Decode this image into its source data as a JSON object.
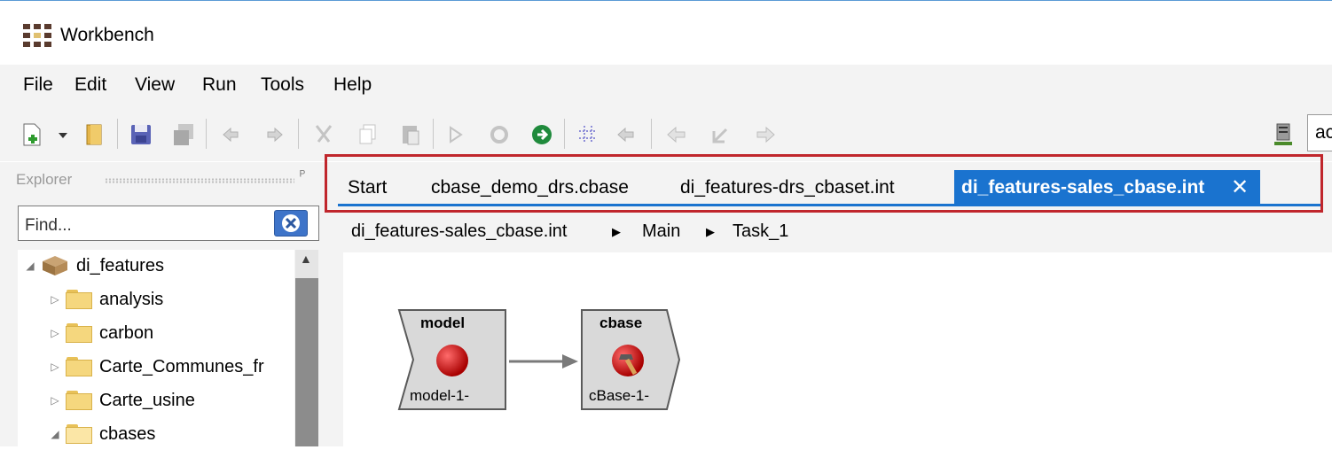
{
  "window": {
    "title": "Workbench"
  },
  "menu": [
    "File",
    "Edit",
    "View",
    "Run",
    "Tools",
    "Help"
  ],
  "toolbar": {
    "icons": [
      "new-file-icon",
      "dropdown-arrow-icon",
      "open-icon",
      "save-icon",
      "save-all-icon",
      "undo-icon",
      "redo-icon",
      "cut-icon",
      "copy-icon",
      "paste-icon",
      "run-icon",
      "refresh-icon",
      "go-icon",
      "grid-icon",
      "back-icon",
      "prev-icon",
      "export-icon",
      "next-icon",
      "server-icon"
    ],
    "search_value": "ac"
  },
  "explorer": {
    "title": "Explorer",
    "find_placeholder": "Find...",
    "tree": [
      {
        "label": "di_features",
        "expanded": true,
        "level": 0,
        "icon": "package-icon"
      },
      {
        "label": "analysis",
        "expanded": false,
        "level": 1,
        "icon": "folder-icon"
      },
      {
        "label": "carbon",
        "expanded": false,
        "level": 1,
        "icon": "folder-icon"
      },
      {
        "label": "Carte_Communes_fr",
        "expanded": false,
        "level": 1,
        "icon": "folder-icon"
      },
      {
        "label": "Carte_usine",
        "expanded": false,
        "level": 1,
        "icon": "folder-icon"
      },
      {
        "label": "cbases",
        "expanded": true,
        "level": 1,
        "icon": "folder-open-icon"
      }
    ]
  },
  "editor": {
    "tabs": [
      {
        "label": "Start",
        "active": false
      },
      {
        "label": "cbase_demo_drs.cbase",
        "active": false
      },
      {
        "label": "di_features-drs_cbaset.int",
        "active": false
      },
      {
        "label": "di_features-sales_cbase.int",
        "active": true
      }
    ],
    "breadcrumb": [
      "di_features-sales_cbase.int",
      "Main",
      "Task_1"
    ],
    "nodes": [
      {
        "title": "model",
        "label": "model-1-"
      },
      {
        "title": "cbase",
        "label": "cBase-1-"
      }
    ]
  },
  "colors": {
    "accent": "#1a73cf",
    "highlight": "#c0262c"
  }
}
